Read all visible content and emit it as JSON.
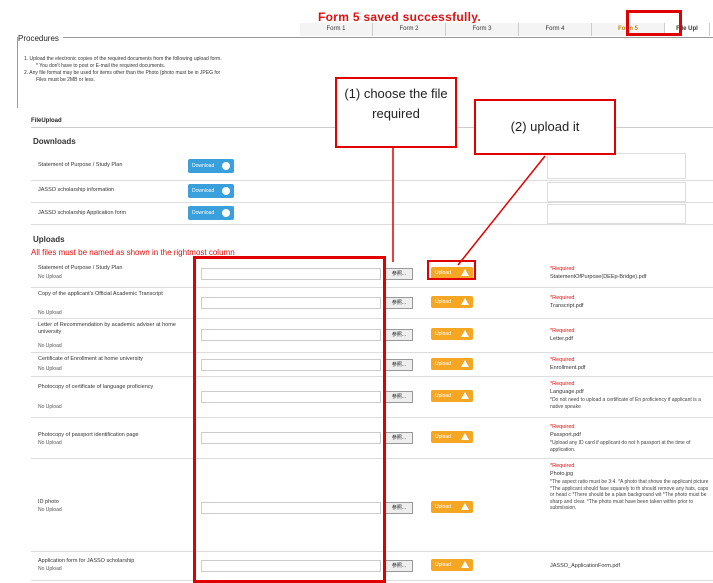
{
  "saved_message": "Form 5 saved successfully.",
  "tabs": [
    "Form 1",
    "Form 2",
    "Form 3",
    "Form 4",
    "Form 5",
    "File Upl"
  ],
  "procedures": {
    "title": "Procedures",
    "line1": "1.  Upload the electronic copies of the required documents from the following upload form.",
    "line1b": "* You don't have to post or E-mail the required documents.",
    "line2": "2.  Any file format may be used for items other than the Photo (photo must be in JPEG for",
    "line2b": "Files must be 2MB or less."
  },
  "fileupload_label": "FileUpload",
  "downloads": {
    "title": "Downloads",
    "button_label": "Download",
    "items": [
      "Statement of Purpose / Study Plan",
      "JASSO scholarship information",
      "JASSO scholarship Application form"
    ]
  },
  "uploads": {
    "title": "Uploads",
    "warning": "All files must be named as shown in the rightmost column",
    "browse_label": "参照...",
    "upload_label": "Upload",
    "items": [
      {
        "label": "Statement of Purpose / Study Plan",
        "status": "No Upload",
        "req": "*Required",
        "file": "StatementOfPurpose(DEEp-Bridge).pdf",
        "note": ""
      },
      {
        "label": "Copy of the applicant's Official Academic Transcript",
        "status": "No Upload",
        "req": "*Required",
        "file": "Transcript.pdf",
        "note": ""
      },
      {
        "label": "Letter of Recommendation by academic adviser at home university",
        "status": "No Upload",
        "req": "*Required",
        "file": "Letter.pdf",
        "note": ""
      },
      {
        "label": "Certificate of Enrollment at home university",
        "status": "No Upload",
        "req": "*Required",
        "file": "Enrollment.pdf",
        "note": ""
      },
      {
        "label": "Photocopy of certificate of language proficiency",
        "status": "No Upload",
        "req": "*Required",
        "file": "Language.pdf",
        "note": "*Do not need to upload a certificate of En proficiency if applicant is a native speake"
      },
      {
        "label": "Photocopy of passport identification page",
        "status": "No Upload",
        "req": "*Required",
        "file": "Passport.pdf",
        "note": "*Upload any ID card if applicant do not h passport at the time of application."
      },
      {
        "label": "ID photo",
        "status": "No Upload",
        "req": "*Required",
        "file": "Photo.jpg",
        "note": "*The aspect ratio must be 3:4. *A photo that shows the applicant picture *The applicant should fase squarely to th should remove any hats, caps or head c *There should be a plain background wit *The photo must be sharp and clear. *The photo must have been taken within prior to submission."
      },
      {
        "label": "Application form for JASSO scholarship",
        "status": "No Upload",
        "req": "",
        "file": "JASSO_ApplicationForm.pdf",
        "note": ""
      }
    ]
  },
  "callouts": {
    "choose": "(1) choose the file required",
    "upload": "(2) upload it"
  },
  "colors": {
    "accent_red": "#e00000",
    "upload_orange": "#f5a623",
    "download_blue": "#3aa0dc"
  }
}
